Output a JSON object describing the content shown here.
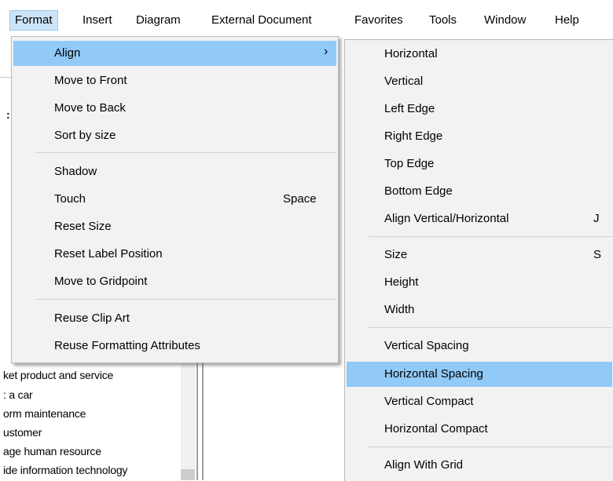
{
  "menubar": {
    "items": [
      "Format",
      "Insert",
      "Diagram",
      "External Document",
      "Favorites",
      "Tools",
      "Window",
      "Help"
    ]
  },
  "format_menu": {
    "align": "Align",
    "arrow": "›",
    "move_to_front": "Move to Front",
    "move_to_back": "Move to Back",
    "sort_by_size": "Sort by size",
    "shadow": "Shadow",
    "touch": "Touch",
    "touch_shortcut": "Space",
    "reset_size": "Reset Size",
    "reset_label_position": "Reset Label Position",
    "move_to_gridpoint": "Move to Gridpoint",
    "reuse_clip_art": "Reuse Clip Art",
    "reuse_formatting_attributes": "Reuse Formatting Attributes"
  },
  "align_menu": {
    "horizontal": "Horizontal",
    "vertical": "Vertical",
    "left_edge": "Left Edge",
    "right_edge": "Right Edge",
    "top_edge": "Top Edge",
    "bottom_edge": "Bottom Edge",
    "align_vertical_horizontal": "Align Vertical/Horizontal",
    "align_vertical_horizontal_shortcut": "J",
    "size": "Size",
    "size_shortcut": "S",
    "height": "Height",
    "width": "Width",
    "vertical_spacing": "Vertical Spacing",
    "horizontal_spacing": "Horizontal Spacing",
    "vertical_compact": "Vertical Compact",
    "horizontal_compact": "Horizontal Compact",
    "align_with_grid": "Align With Grid"
  },
  "background_tree": {
    "rows": [
      "ket product and service",
      ": a car",
      "orm maintenance",
      "ustomer",
      "age human resource",
      "ide information technology"
    ]
  }
}
